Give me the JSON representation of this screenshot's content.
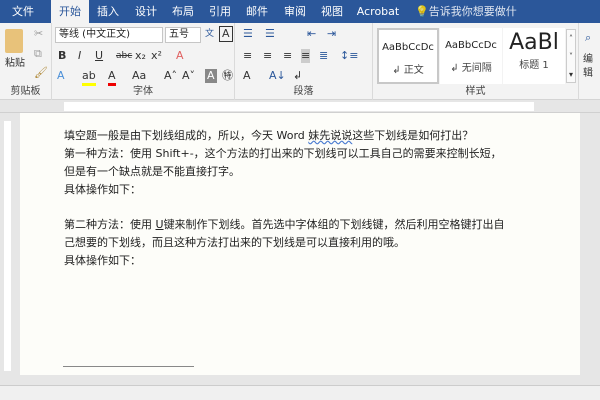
{
  "tabs": [
    "文件",
    "开始",
    "插入",
    "设计",
    "布局",
    "引用",
    "邮件",
    "审阅",
    "视图",
    "Acrobat"
  ],
  "tell_me": "告诉我你想要做什么",
  "clipboard": {
    "paste": "粘贴",
    "label": "剪贴板"
  },
  "font": {
    "name": "等线 (中文正文)",
    "size": "五号",
    "label": "字体"
  },
  "paragraph": {
    "label": "段落"
  },
  "styles": {
    "label": "样式",
    "items": [
      {
        "preview": "AaBbCcDc",
        "name": "↲ 正文"
      },
      {
        "preview": "AaBbCcDc",
        "name": "↲ 无间隔"
      },
      {
        "preview": "AaBl",
        "name": "标题 1"
      }
    ]
  },
  "editing": {
    "label": "编辑"
  },
  "doc": {
    "lines": [
      "填空题一般是由下划线组成的，所以，今天 Word ",
      "妹先说说",
      "这些下划线是如何打出？",
      "第一种方法：使用 Shift+-，这个方法的打出来的下划线可以工具自己的需要来控制长短，",
      "但是有一个缺点就是不能直接打字。",
      "具体操作如下：",
      "第二种方法：使用 ",
      "U",
      "键来制作下划线。首先选中字体组的下划线键，然后利用空格键打出自",
      "己想要的下划线，而且这种方法打出来的下划线是可以直接利用的哦。",
      "具体操作如下："
    ]
  }
}
